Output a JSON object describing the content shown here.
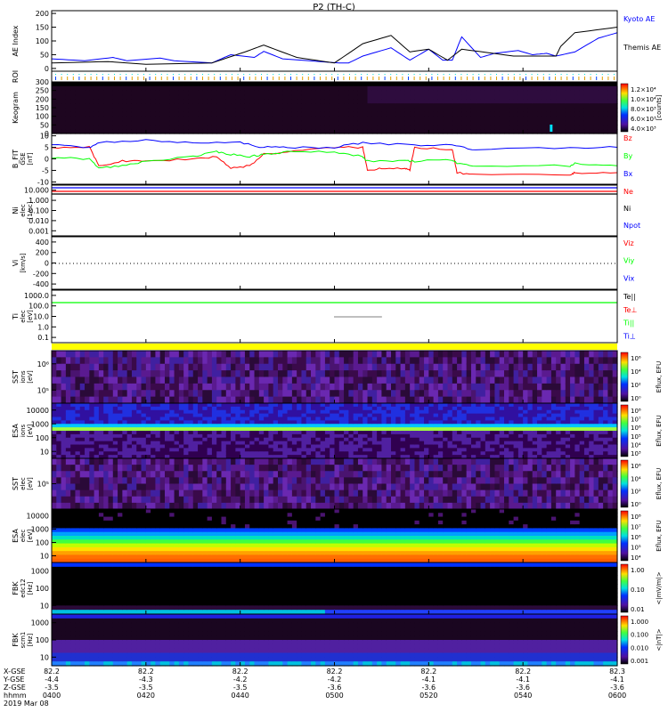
{
  "chart_data": {
    "type": "line",
    "title": "P2 (TH-C)",
    "time_range_min": [
      0,
      120
    ],
    "panels": [
      {
        "id": "ae",
        "ylabel": "AE Index",
        "ylim": [
          -10,
          210
        ],
        "ticks": [
          "200",
          "150",
          "100",
          "50",
          "0"
        ],
        "tickvals": [
          200,
          150,
          100,
          50,
          0
        ],
        "series": [
          {
            "name": "Kyoto AE",
            "color": "#0000ff",
            "t": [
              0,
              7,
              13,
              16,
              23,
              26,
              34,
              38,
              43,
              45,
              49,
              61,
              63,
              66,
              72,
              76,
              80,
              83,
              85,
              87,
              91,
              94,
              99,
              102,
              105,
              107,
              111,
              116,
              120
            ],
            "v": [
              35,
              28,
              40,
              28,
              38,
              28,
              20,
              50,
              40,
              62,
              35,
              20,
              20,
              45,
              75,
              30,
              70,
              30,
              30,
              115,
              40,
              55,
              65,
              50,
              55,
              45,
              60,
              110,
              130
            ]
          },
          {
            "name": "Themis AE",
            "color": "#000000",
            "t": [
              0,
              12,
              20,
              34,
              41,
              45,
              52,
              60,
              66,
              72,
              76,
              80,
              84,
              87,
              98,
              107,
              108,
              111,
              120
            ],
            "v": [
              20,
              25,
              15,
              20,
              60,
              85,
              40,
              20,
              90,
              120,
              60,
              70,
              30,
              70,
              45,
              45,
              80,
              130,
              150
            ]
          }
        ]
      },
      {
        "id": "roi",
        "ylabel": "ROI"
      },
      {
        "id": "keogram",
        "ylabel": "Keogram",
        "ticks": [
          "300",
          "250",
          "200",
          "150",
          "100",
          "50",
          "0"
        ],
        "tickvals": [
          300,
          250,
          200,
          150,
          100,
          50,
          0
        ],
        "ylim": [
          0,
          300
        ],
        "colorbar": {
          "label": "[counts]",
          "ticks": [
            "1.2×10⁴",
            "1.0×10⁴",
            "8.0×10³",
            "6.0×10³",
            "4.0×10³"
          ]
        }
      },
      {
        "id": "bfit",
        "ylabel": "B_FIT",
        "ylabel2": "GSE",
        "ylabel3": "[nT]",
        "ylim": [
          -11,
          11
        ],
        "ticks": [
          "10",
          "5",
          "0",
          "-5",
          "-10"
        ],
        "tickvals": [
          10,
          5,
          0,
          -5,
          -10
        ],
        "series": [
          {
            "name": "Bz",
            "color": "#ff0000",
            "t": [
              0,
              8,
              10,
              15,
              20,
              30,
              35,
              38,
              42,
              45,
              50,
              60,
              66,
              67,
              70,
              75,
              76,
              77,
              85,
              86,
              90,
              110,
              111,
              120
            ],
            "v": [
              5,
              5,
              -3,
              -1,
              -1,
              0,
              1,
              -4,
              -3,
              2,
              3,
              5,
              5,
              -5,
              -4,
              -4,
              -5,
              5,
              4,
              -6,
              -7,
              -7,
              -6,
              -6
            ]
          },
          {
            "name": "By",
            "color": "#00ff00",
            "t": [
              0,
              8,
              10,
              15,
              20,
              30,
              35,
              38,
              42,
              45,
              50,
              60,
              66,
              67,
              75,
              77,
              85,
              86,
              90,
              110,
              111,
              120
            ],
            "v": [
              0.5,
              0,
              -4,
              -3,
              -1,
              1,
              3,
              2,
              1,
              2,
              3,
              3,
              1,
              -1,
              -1,
              -1,
              -0.5,
              -2,
              -3,
              -3,
              -2,
              -3
            ]
          },
          {
            "name": "Bx",
            "color": "#0000ff",
            "t": [
              0,
              8,
              10,
              20,
              30,
              40,
              45,
              50,
              60,
              66,
              77,
              85,
              90,
              110,
              120
            ],
            "v": [
              6,
              5,
              7,
              8,
              7,
              7,
              5,
              5,
              5,
              7,
              6,
              6,
              4,
              5,
              5
            ]
          }
        ]
      },
      {
        "id": "ni",
        "ylabel": "Ni",
        "ylabel2": "elec",
        "ylabel3": "[1/cc]",
        "ticks": [
          "10.000",
          "1.000",
          "0.100",
          "0.010",
          "0.001"
        ],
        "legend": [
          {
            "name": "Ne",
            "color": "#ff0000"
          },
          {
            "name": "Ni",
            "color": "#000000"
          },
          {
            "name": "Npot",
            "color": "#0000ff"
          }
        ]
      },
      {
        "id": "vi",
        "ylabel": "Vi",
        "ylabel2": "[km/s]",
        "ticks": [
          "400",
          "200",
          "0",
          "-200",
          "-400"
        ],
        "legend": [
          {
            "name": "Viz",
            "color": "#ff0000"
          },
          {
            "name": "Viy",
            "color": "#00ff00"
          },
          {
            "name": "Vix",
            "color": "#0000ff"
          }
        ]
      },
      {
        "id": "t",
        "ylabel": "Ti",
        "ylabel2": "elec",
        "ylabel3": "[eV]",
        "ticks": [
          "1000.0",
          "100.0",
          "10.0",
          "1.0",
          "0.1"
        ],
        "legend": [
          {
            "name": "Te||",
            "color": "#000000"
          },
          {
            "name": "Te⊥",
            "color": "#ff0000"
          },
          {
            "name": "Ti||",
            "color": "#00ff00"
          },
          {
            "name": "Ti⊥",
            "color": "#0000ff"
          }
        ]
      },
      {
        "id": "sst_i",
        "ylabel": "SST",
        "ylabel2": "ions",
        "ylabel3": "[eV]",
        "ticks": [
          "10⁶",
          "10⁵"
        ],
        "colorbar": {
          "label": "Eflux, EFU",
          "ticks": [
            "10⁶",
            "10⁴",
            "10²",
            "10⁰"
          ]
        }
      },
      {
        "id": "esa_i",
        "ylabel": "ESA",
        "ylabel2": "ions",
        "ylabel3": "[eV]",
        "ticks": [
          "10000",
          "1000",
          "100",
          "10"
        ],
        "colorbar": {
          "label": "Eflux, EFU",
          "ticks": [
            "10⁸",
            "10⁷",
            "10⁶",
            "10⁵",
            "10⁴",
            "10³"
          ]
        }
      },
      {
        "id": "sst_e",
        "ylabel": "SST",
        "ylabel2": "elec",
        "ylabel3": "[eV]",
        "ticks": [
          "10⁵"
        ],
        "colorbar": {
          "label": "Eflux, EFU",
          "ticks": [
            "10⁶",
            "10⁴",
            "10²",
            "10⁰"
          ]
        }
      },
      {
        "id": "esa_e",
        "ylabel": "ESA",
        "ylabel2": "elec",
        "ylabel3": "[eV]",
        "ticks": [
          "10000",
          "1000",
          "100",
          "10"
        ],
        "colorbar": {
          "label": "Eflux, EFU",
          "ticks": [
            "10⁸",
            "10⁷",
            "10⁶",
            "10⁵",
            "10⁴"
          ]
        }
      },
      {
        "id": "fbk_e",
        "ylabel": "FBK",
        "ylabel2": "edc12",
        "ylabel3": "[Hz]",
        "ticks": [
          "1000",
          "100",
          "10"
        ],
        "colorbar": {
          "label": "<|mV/m|>",
          "ticks": [
            "1.00",
            "0.10",
            "0.01"
          ]
        }
      },
      {
        "id": "fbk_b",
        "ylabel": "FBK",
        "ylabel2": "scm1",
        "ylabel3": "[Hz]",
        "ticks": [
          "1000",
          "100",
          "10"
        ],
        "colorbar": {
          "label": "<|nT|>",
          "ticks": [
            "1.000",
            "0.100",
            "0.010",
            "0.001"
          ]
        }
      }
    ],
    "footer": {
      "row_labels": [
        "X-GSE",
        "Y-GSE",
        "Z-GSE",
        "hhmm"
      ],
      "columns": [
        {
          "x": "82.2",
          "y": "-4.4",
          "z": "-3.5",
          "t": "0400"
        },
        {
          "x": "82.2",
          "y": "-4.3",
          "z": "-3.5",
          "t": "0420"
        },
        {
          "x": "82.2",
          "y": "-4.2",
          "z": "-3.5",
          "t": "0440"
        },
        {
          "x": "82.2",
          "y": "-4.2",
          "z": "-3.6",
          "t": "0500"
        },
        {
          "x": "82.2",
          "y": "-4.1",
          "z": "-3.6",
          "t": "0520"
        },
        {
          "x": "82.2",
          "y": "-4.1",
          "z": "-3.6",
          "t": "0540"
        },
        {
          "x": "82.3",
          "y": "-4.1",
          "z": "-3.6",
          "t": "0600"
        }
      ],
      "date": "2019 Mar 08"
    }
  }
}
